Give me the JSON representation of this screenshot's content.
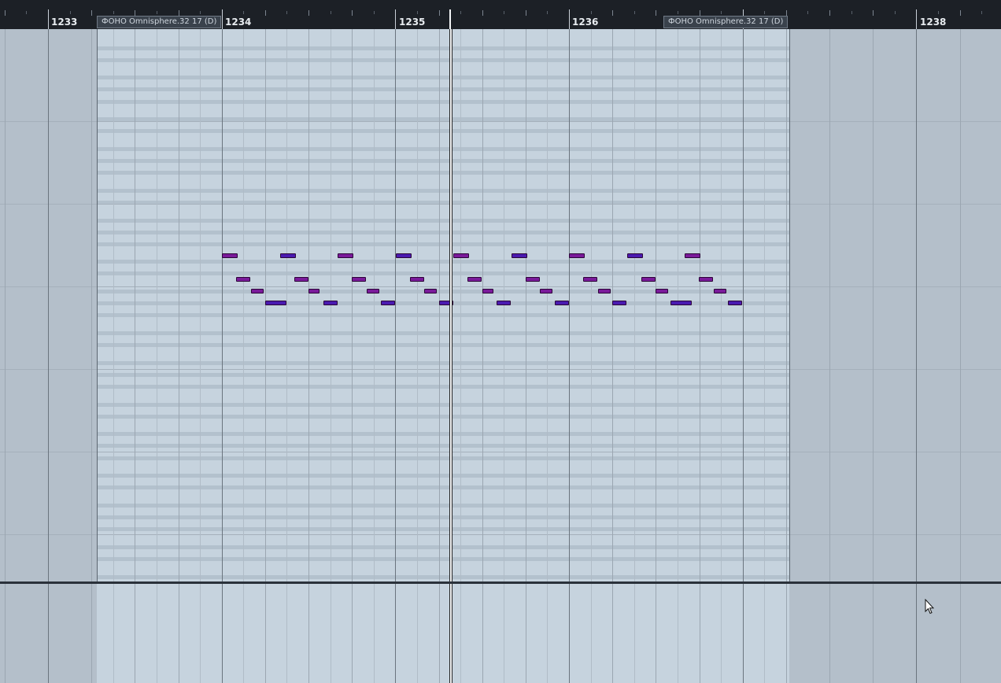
{
  "ruler": {
    "bars": [
      {
        "label": "1233"
      },
      {
        "label": "1234"
      },
      {
        "label": "1235"
      },
      {
        "label": "1236"
      },
      {
        "label": "1238"
      }
    ],
    "part_tags": [
      {
        "label": "ФОНО Omnisphere.32 17 (D)"
      },
      {
        "label": "ФОНО Omnisphere.32 17 (D)"
      }
    ]
  },
  "colors": {
    "note_high_velocity": "#7a1a9a",
    "note_low_velocity": "#4a1ab0",
    "playhead": "#f4f6f8"
  },
  "notes_lanes": [
    {
      "lane": 0,
      "starts_beat": [
        0,
        1,
        2,
        3,
        4,
        5,
        6,
        7,
        8
      ]
    },
    {
      "lane": 1,
      "starts_beat": [
        0.25,
        1.25,
        2.25,
        3.25,
        4.25,
        5.25,
        6.25,
        7.25,
        8.25
      ]
    },
    {
      "lane": 2,
      "starts_beat": [
        0.5,
        1.5,
        2.5,
        3.5,
        4.5,
        5.5,
        6.5,
        7.5,
        8.5
      ]
    },
    {
      "lane": 3,
      "starts_beat": [
        0.75,
        1.75,
        2.75,
        3.75,
        4.75,
        5.75,
        6.75,
        7.75,
        8.75
      ]
    }
  ],
  "cursor": {
    "icon": "mouse-pointer-icon"
  }
}
